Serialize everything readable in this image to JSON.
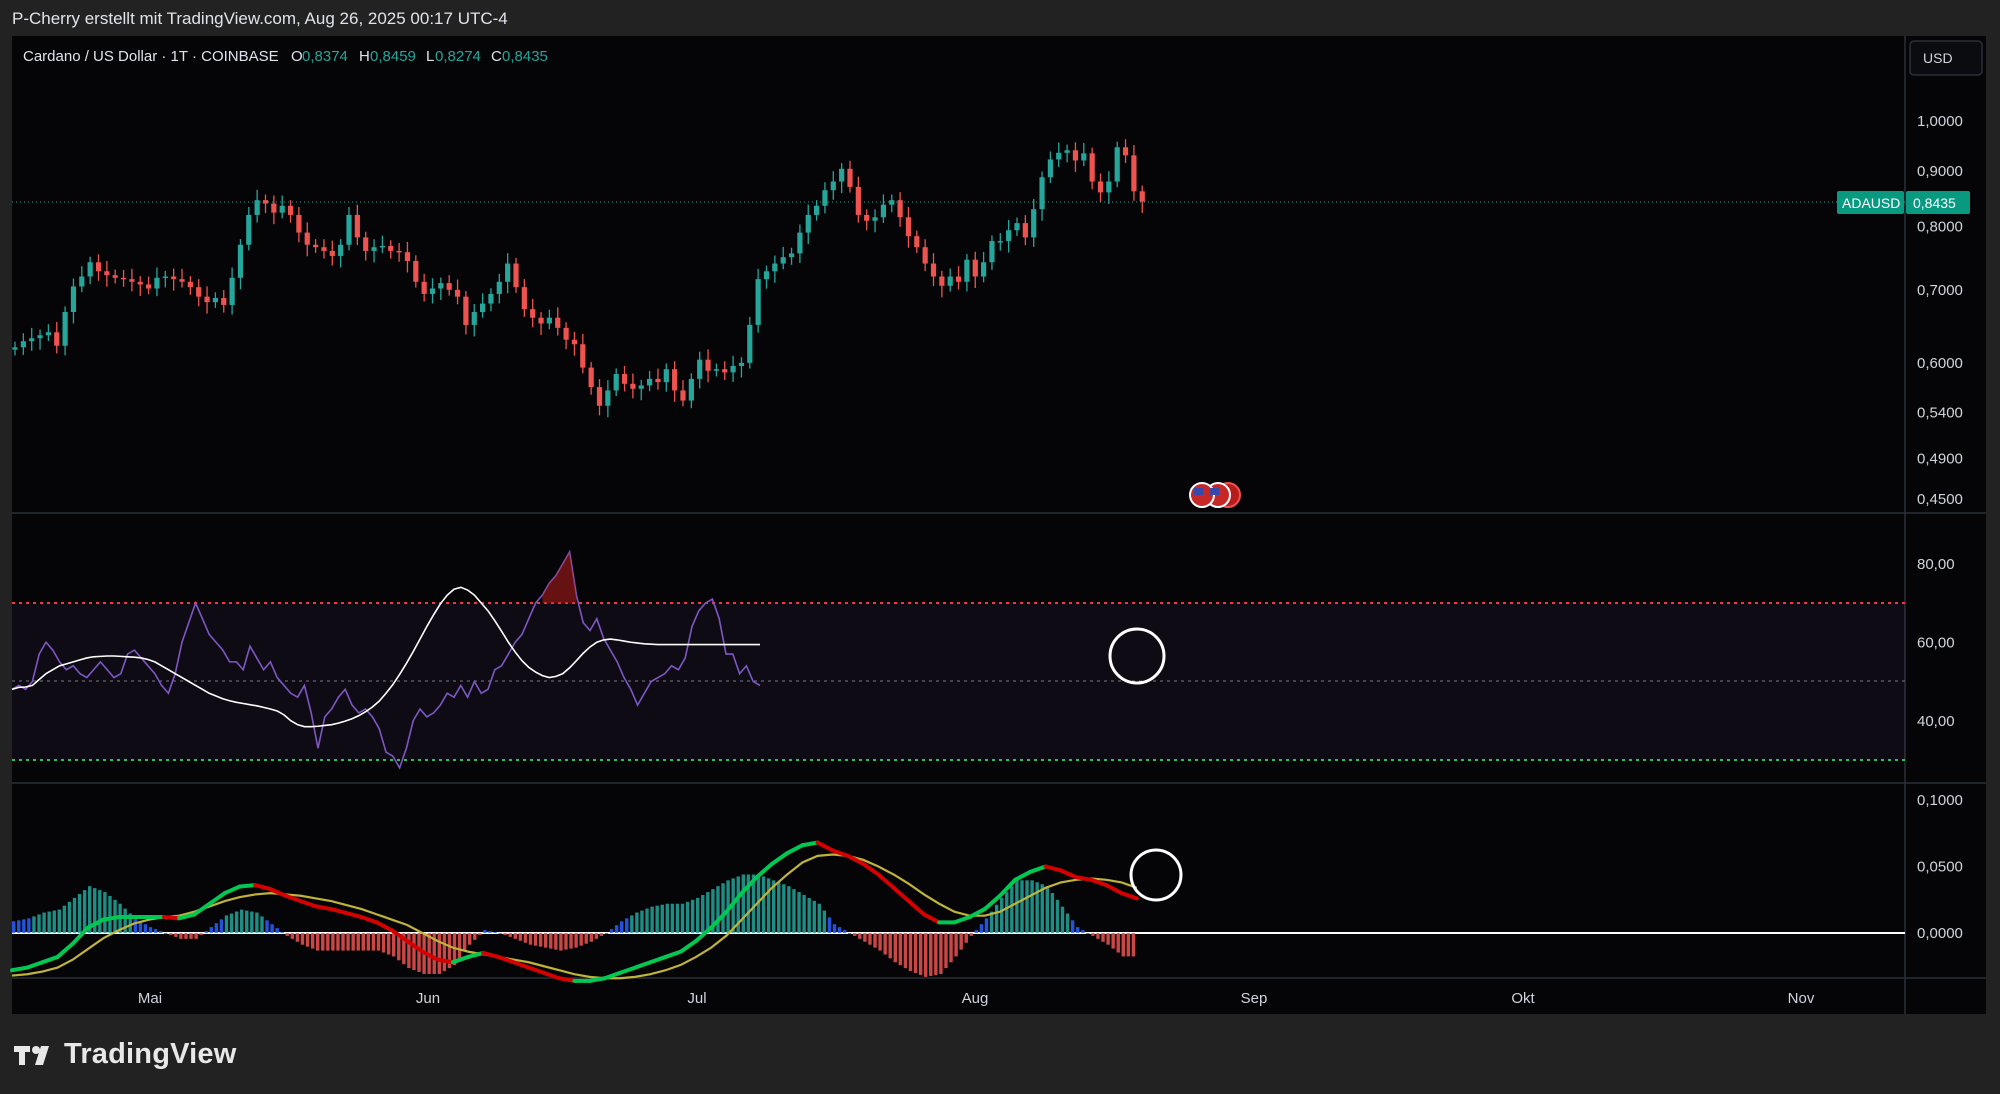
{
  "header": {
    "author_line": "P-Cherry erstellt mit TradingView.com, Aug 26, 2025 00:17 UTC-4"
  },
  "legend": {
    "symbol": "Cardano / US Dollar · 1T · COINBASE",
    "o_label": "O",
    "o_value": "0,8374",
    "h_label": "H",
    "h_value": "0,8459",
    "l_label": "L",
    "l_value": "0,8274",
    "c_label": "C",
    "c_value": "0,8435"
  },
  "currency_button": "USD",
  "price_tag": {
    "symbol": "ADAUSD",
    "value": "0,8435"
  },
  "footer": {
    "brand": "TradingView"
  },
  "colors": {
    "up": "#26a69a",
    "down": "#ef5350",
    "rsi": "#7e57c2",
    "rsi_ma": "#ffffff",
    "macd_up": "#00c853",
    "macd_down": "#d50000",
    "signal": "#c0b33a"
  },
  "chart_data": [
    {
      "type": "candlestick",
      "name": "price",
      "y_scale": "log",
      "y_ticks": [
        "1,0000",
        "0,9000",
        "0,8000",
        "0,7000",
        "0,6000",
        "0,5400",
        "0,4900",
        "0,4500"
      ],
      "y_tick_values": [
        1.0,
        0.9,
        0.8,
        0.7,
        0.6,
        0.54,
        0.49,
        0.45
      ],
      "x_labels": [
        "Mai",
        "Jun",
        "Jul",
        "Aug",
        "Sep",
        "Okt",
        "Nov"
      ],
      "closes": [
        0.62,
        0.628,
        0.632,
        0.636,
        0.64,
        0.622,
        0.668,
        0.705,
        0.72,
        0.742,
        0.728,
        0.722,
        0.718,
        0.716,
        0.712,
        0.708,
        0.702,
        0.718,
        0.72,
        0.716,
        0.712,
        0.704,
        0.69,
        0.682,
        0.688,
        0.678,
        0.718,
        0.77,
        0.82,
        0.846,
        0.84,
        0.824,
        0.836,
        0.82,
        0.79,
        0.77,
        0.766,
        0.76,
        0.752,
        0.77,
        0.82,
        0.782,
        0.76,
        0.766,
        0.768,
        0.76,
        0.758,
        0.744,
        0.712,
        0.694,
        0.702,
        0.71,
        0.7,
        0.69,
        0.65,
        0.668,
        0.68,
        0.694,
        0.712,
        0.74,
        0.704,
        0.672,
        0.66,
        0.652,
        0.66,
        0.646,
        0.63,
        0.624,
        0.594,
        0.57,
        0.548,
        0.566,
        0.586,
        0.574,
        0.568,
        0.572,
        0.58,
        0.576,
        0.592,
        0.566,
        0.554,
        0.58,
        0.604,
        0.59,
        0.592,
        0.588,
        0.596,
        0.6,
        0.65,
        0.716,
        0.728,
        0.74,
        0.75,
        0.756,
        0.79,
        0.82,
        0.836,
        0.864,
        0.88,
        0.904,
        0.87,
        0.82,
        0.81,
        0.816,
        0.838,
        0.846,
        0.816,
        0.784,
        0.766,
        0.74,
        0.72,
        0.706,
        0.72,
        0.712,
        0.746,
        0.72,
        0.742,
        0.776,
        0.776,
        0.794,
        0.806,
        0.782,
        0.83,
        0.888,
        0.922,
        0.935,
        0.94,
        0.92,
        0.934,
        0.88,
        0.86,
        0.88,
        0.946,
        0.93,
        0.862,
        0.8435
      ]
    },
    {
      "type": "line",
      "name": "RSI",
      "y_ticks": [
        "80,00",
        "60,00",
        "40,00"
      ],
      "y_tick_values": [
        80,
        60,
        40
      ],
      "upper_band": 70,
      "middle_band": 50,
      "lower_band": 30,
      "rsi": [
        48,
        49,
        48,
        50,
        57,
        60,
        58,
        55,
        53,
        54,
        52,
        51,
        53,
        55,
        53,
        51,
        52,
        57,
        58,
        56,
        54,
        52,
        49,
        47,
        52,
        60,
        65,
        70,
        66,
        62,
        60,
        58,
        55,
        55,
        53,
        59,
        56,
        53,
        55,
        51,
        49,
        47,
        46,
        49,
        42,
        33,
        41,
        43,
        46,
        48,
        44,
        42,
        43,
        41,
        38,
        32,
        31,
        28,
        33,
        40,
        43,
        41,
        42,
        44,
        47,
        46,
        49,
        46,
        50,
        47,
        48,
        53,
        54,
        57,
        60,
        62,
        66,
        70,
        72,
        75,
        77,
        80,
        83,
        72,
        65,
        63,
        66,
        61,
        58,
        55,
        51,
        48,
        44,
        47,
        50,
        51,
        52,
        54,
        53,
        56,
        64,
        68,
        70,
        71,
        66,
        57,
        57,
        52,
        54,
        50,
        49
      ],
      "rsi_ma": [
        48,
        48.5,
        48.6,
        49,
        50.5,
        52,
        53,
        54,
        54.5,
        55,
        55.5,
        56,
        56.3,
        56.4,
        56.5,
        56.5,
        56.4,
        56.3,
        56.2,
        56,
        55.6,
        55,
        54,
        53,
        52,
        51,
        50,
        49,
        48,
        47,
        46.3,
        45.6,
        45.1,
        44.7,
        44.4,
        44.1,
        43.8,
        43.4,
        43,
        42.5,
        41.5,
        40,
        39,
        38.5,
        38.5,
        38.6,
        38.8,
        39,
        39.4,
        39.9,
        40.5,
        41.3,
        42.3,
        43.5,
        45,
        47,
        49.2,
        51.8,
        54.6,
        57.6,
        60.8,
        64,
        67,
        69.8,
        72,
        73.5,
        74,
        73.3,
        72,
        70,
        68,
        65.5,
        62.8,
        60,
        57.5,
        55.3,
        53.6,
        52.4,
        51.5,
        51,
        51.3,
        52,
        53.5,
        55.3,
        57.2,
        58.8,
        60,
        60.6,
        60.8,
        60.6,
        60.3,
        60,
        59.8,
        59.6,
        59.5,
        59.4,
        59.4,
        59.4,
        59.4,
        59.4,
        59.4,
        59.4,
        59.4,
        59.4,
        59.4,
        59.4,
        59.4,
        59.4,
        59.4,
        59.4,
        59.4
      ]
    },
    {
      "type": "line",
      "name": "MACD",
      "y_ticks": [
        "0,1000",
        "0,0500",
        "0,0000"
      ],
      "y_tick_values": [
        0.1,
        0.05,
        0.0
      ],
      "macd": [
        -0.028,
        -0.026,
        -0.022,
        -0.018,
        -0.008,
        0.004,
        0.01,
        0.012,
        0.012,
        0.012,
        0.012,
        0.011,
        0.014,
        0.022,
        0.03,
        0.035,
        0.036,
        0.033,
        0.028,
        0.024,
        0.02,
        0.018,
        0.015,
        0.012,
        0.008,
        0.002,
        -0.006,
        -0.014,
        -0.02,
        -0.022,
        -0.018,
        -0.015,
        -0.018,
        -0.022,
        -0.026,
        -0.03,
        -0.034,
        -0.036,
        -0.036,
        -0.034,
        -0.03,
        -0.026,
        -0.022,
        -0.018,
        -0.014,
        -0.006,
        0.004,
        0.016,
        0.03,
        0.042,
        0.052,
        0.06,
        0.066,
        0.068,
        0.062,
        0.058,
        0.052,
        0.044,
        0.034,
        0.024,
        0.014,
        0.008,
        0.008,
        0.012,
        0.018,
        0.028,
        0.04,
        0.046,
        0.05,
        0.047,
        0.042,
        0.04,
        0.036,
        0.03,
        0.026
      ],
      "signal": [
        -0.032,
        -0.031,
        -0.029,
        -0.026,
        -0.02,
        -0.012,
        -0.004,
        0.002,
        0.007,
        0.01,
        0.012,
        0.013,
        0.016,
        0.02,
        0.024,
        0.027,
        0.029,
        0.03,
        0.029,
        0.028,
        0.026,
        0.024,
        0.021,
        0.018,
        0.014,
        0.01,
        0.006,
        0.0,
        -0.006,
        -0.011,
        -0.014,
        -0.016,
        -0.018,
        -0.02,
        -0.022,
        -0.025,
        -0.028,
        -0.031,
        -0.033,
        -0.034,
        -0.034,
        -0.033,
        -0.031,
        -0.028,
        -0.024,
        -0.018,
        -0.011,
        -0.002,
        0.01,
        0.022,
        0.034,
        0.044,
        0.053,
        0.058,
        0.059,
        0.058,
        0.055,
        0.05,
        0.044,
        0.037,
        0.029,
        0.022,
        0.016,
        0.013,
        0.013,
        0.016,
        0.022,
        0.028,
        0.034,
        0.038,
        0.04,
        0.041,
        0.04,
        0.038,
        0.034
      ]
    }
  ]
}
